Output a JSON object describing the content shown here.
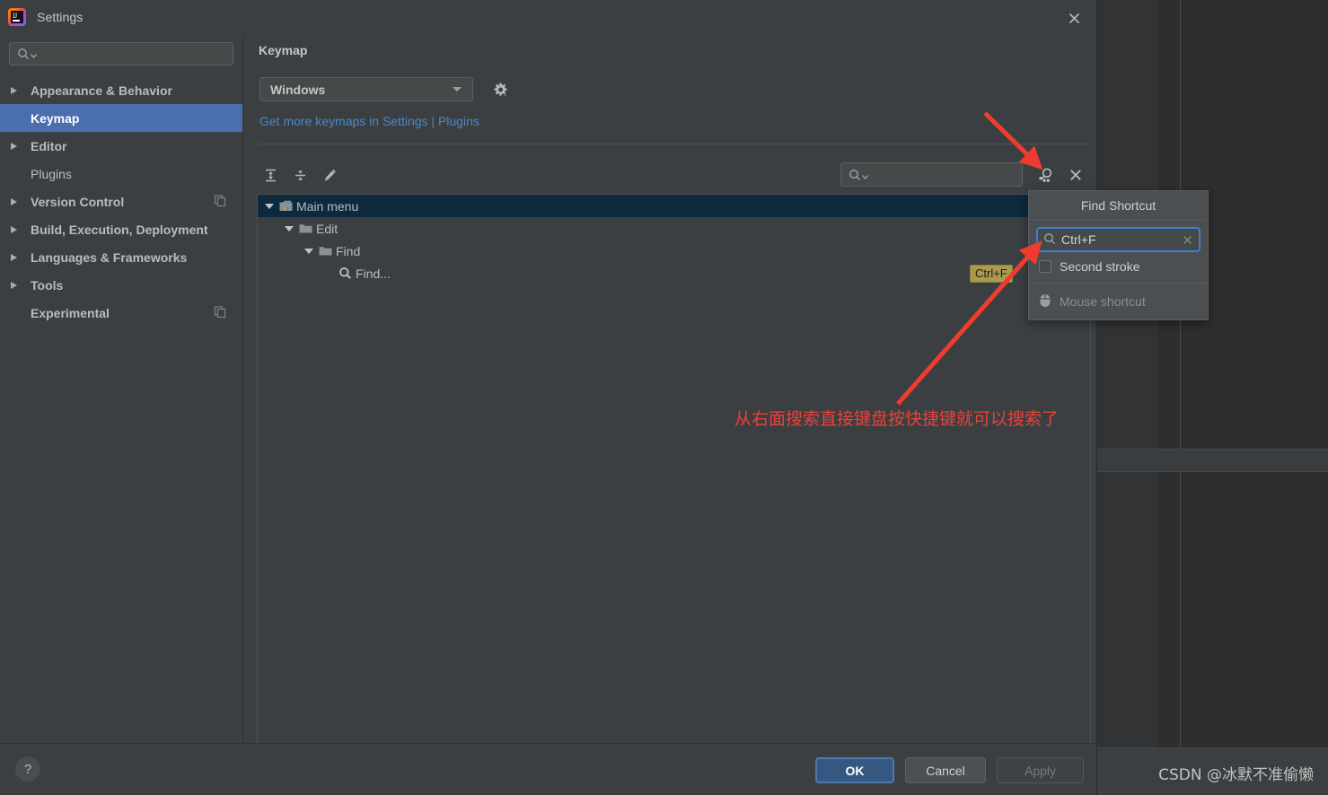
{
  "window": {
    "title": "Settings",
    "logo_icon": "intellij-idea-logo",
    "close_icon": "close-icon"
  },
  "sidebar": {
    "search": {
      "placeholder": "",
      "value": "",
      "icon": "search-icon"
    },
    "items": [
      {
        "label": "Appearance & Behavior",
        "expandable": true,
        "selected": false,
        "badge_icon": ""
      },
      {
        "label": "Keymap",
        "expandable": false,
        "selected": true,
        "badge_icon": ""
      },
      {
        "label": "Editor",
        "expandable": true,
        "selected": false,
        "badge_icon": ""
      },
      {
        "label": "Plugins",
        "expandable": false,
        "selected": false,
        "badge_icon": ""
      },
      {
        "label": "Version Control",
        "expandable": true,
        "selected": false,
        "badge_icon": "copy-icon"
      },
      {
        "label": "Build, Execution, Deployment",
        "expandable": true,
        "selected": false,
        "badge_icon": ""
      },
      {
        "label": "Languages & Frameworks",
        "expandable": true,
        "selected": false,
        "badge_icon": ""
      },
      {
        "label": "Tools",
        "expandable": true,
        "selected": false,
        "badge_icon": ""
      },
      {
        "label": "Experimental",
        "expandable": false,
        "selected": false,
        "badge_icon": "copy-icon"
      }
    ]
  },
  "content": {
    "title": "Keymap",
    "keymap_select": {
      "value": "Windows",
      "icon": "chevron-down-icon"
    },
    "gear_icon": "gear-dropdown-icon",
    "plugins_link": "Get more keymaps in Settings | Plugins",
    "toolbar": {
      "expand_all_label": "Expand All",
      "collapse_all_label": "Collapse All",
      "edit_label": "Edit Shortcut",
      "search": {
        "placeholder": "",
        "value": "",
        "icon": "search-icon"
      },
      "find_shortcut_label": "Find Actions by Shortcut",
      "clear_filter_label": "Reset Filter"
    },
    "tree": [
      {
        "label": "Main menu",
        "depth": 0,
        "icon": "main-menu-icon",
        "expanded": true,
        "selected": true,
        "shortcut": ""
      },
      {
        "label": "Edit",
        "depth": 1,
        "icon": "folder-icon",
        "expanded": true,
        "selected": false,
        "shortcut": ""
      },
      {
        "label": "Find",
        "depth": 2,
        "icon": "folder-icon",
        "expanded": true,
        "selected": false,
        "shortcut": ""
      },
      {
        "label": "Find...",
        "depth": 3,
        "icon": "search-icon",
        "expanded": false,
        "selected": false,
        "shortcut": "Ctrl+F"
      }
    ]
  },
  "find_shortcut_popup": {
    "title": "Find Shortcut",
    "input": {
      "value": "Ctrl+F",
      "placeholder": "",
      "icon": "search-icon",
      "clear_icon": "clear-icon"
    },
    "second_stroke": {
      "label": "Second stroke",
      "checked": false
    },
    "mouse_shortcut": {
      "label": "Mouse shortcut",
      "icon": "mouse-icon",
      "disabled": true
    }
  },
  "footer": {
    "help_label": "?",
    "ok_label": "OK",
    "cancel_label": "Cancel",
    "apply_label": "Apply"
  },
  "annotation": {
    "text": "从右面搜索直接键盘按快捷键就可以搜索了",
    "color": "#e8413a"
  },
  "watermark": "CSDN @冰默不准偷懒",
  "colors": {
    "accent_selected": "#4b6eaf",
    "link": "#4a88c7",
    "primary_button": "#365880",
    "dialog_bg": "#3c3f41",
    "tree_selected": "#0d293e",
    "shortcut_badge": "#aa9a4d",
    "focus_ring": "#3d7fd4"
  }
}
